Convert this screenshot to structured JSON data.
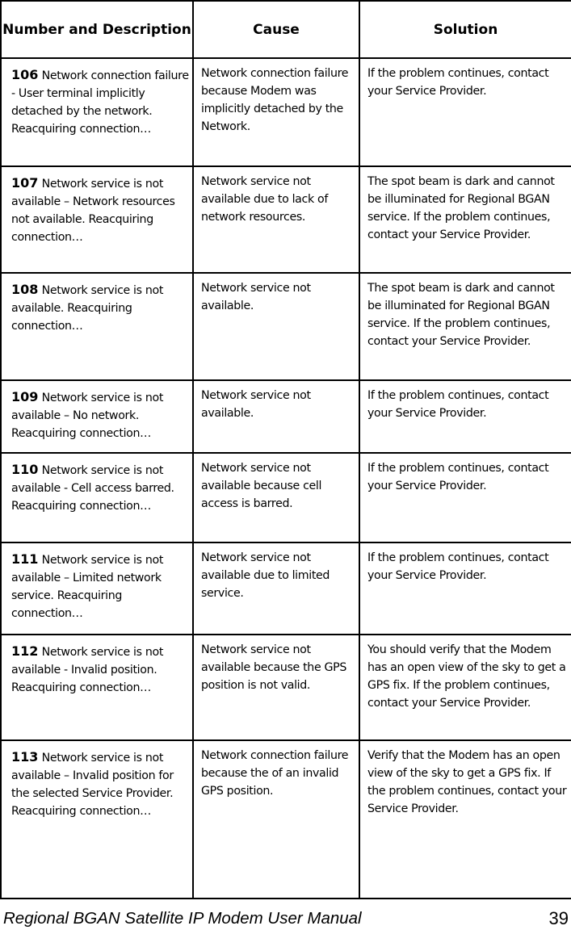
{
  "table": {
    "headers": {
      "number_and_description": "Number and Description",
      "cause": "Cause",
      "solution": "Solution"
    },
    "rows": [
      {
        "number": "106",
        "description": "Network connection failure - User terminal implicitly detached by the network. Reacquiring connection…",
        "cause": "Network connection failure because Modem was implicitly detached by the Network.",
        "solution": "If the problem continues, contact your Service Provider."
      },
      {
        "number": "107",
        "description": "Network service is not available – Network resources not available. Reacquiring connection…",
        "cause": "Network service not available due to lack of network resources.",
        "solution": "The spot beam is dark and cannot be illuminated for Regional BGAN service. If the problem continues, contact your Service Provider."
      },
      {
        "number": "108",
        "description": "Network service is not available. Reacquiring connection…",
        "cause": "Network service not available.",
        "solution": "The spot beam is dark and cannot be illuminated for Regional BGAN service. If the problem continues, contact your Service Provider."
      },
      {
        "number": "109",
        "description": "Network service is not available – No network. Reacquiring connection…",
        "cause": "Network service not available.",
        "solution": "If the problem continues, contact your Service Provider."
      },
      {
        "number": "110",
        "description": "Network service is not available - Cell access barred. Reacquiring connection…",
        "cause": "Network service not available because cell access is barred.",
        "solution": "If the problem continues, contact your Service Provider."
      },
      {
        "number": "111",
        "description": "Network service is not available – Limited network service. Reacquiring connection…",
        "cause": "Network service not available due to limited service.",
        "solution": "If the problem continues, contact your Service Provider."
      },
      {
        "number": "112",
        "description": "Network service is not available - Invalid position. Reacquiring connection…",
        "cause": "Network service not available because the GPS position is not valid.",
        "solution": "You should verify that the Modem has an open view of the sky to get a GPS fix. If the problem continues, contact your Service Provider."
      },
      {
        "number": "113",
        "description": "Network service is not available – Invalid position for the selected Service Provider. Reacquiring connection…",
        "cause": "Network connection failure because the of an invalid GPS position.",
        "solution": "Verify that the Modem has an open view of the sky to get a GPS fix. If the problem continues, contact your Service Provider."
      }
    ]
  },
  "footer": {
    "document_title": "Regional BGAN Satellite IP Modem User Manual",
    "page_number": "39"
  }
}
